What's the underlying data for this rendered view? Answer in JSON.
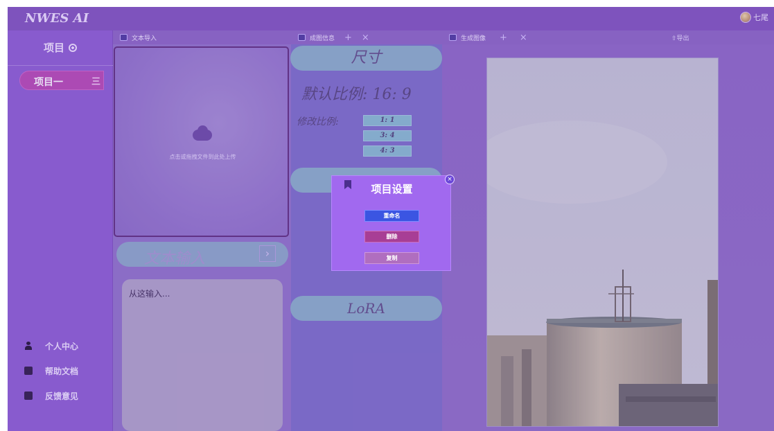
{
  "app": {
    "brand": "NWES AI",
    "user_name": "七尾"
  },
  "sidebar": {
    "header": "项目",
    "project_item": "项目一",
    "project_menu_icon": "三",
    "nav": [
      {
        "label": "个人中心",
        "icon": "person-icon"
      },
      {
        "label": "帮助文档",
        "icon": "help-doc-icon"
      },
      {
        "label": "反馈意见",
        "icon": "feedback-icon"
      }
    ]
  },
  "panels": {
    "text_import": {
      "tab": "文本导入",
      "upload_hint": "点击或拖拽文件到此处上传"
    },
    "text_input": {
      "title": "文本输入",
      "arrow": "›",
      "placeholder": "从这输入..."
    },
    "image_info": {
      "tab": "成图信息",
      "plus": "+",
      "close": "×",
      "dims_title": "尺寸",
      "default_ratio": "默认比例: 16: 9",
      "modify_label": "修改比例:",
      "ratios": [
        "1: 1",
        "3: 4",
        "4: 3"
      ],
      "lora": "LoRA"
    },
    "generated_image": {
      "tab": "生成图像",
      "plus": "+",
      "close": "×",
      "export": "导出"
    }
  },
  "modal": {
    "title": "项目设置",
    "close": "×",
    "buttons": {
      "rename": "重命名",
      "delete": "删除",
      "copy": "复制"
    }
  },
  "colors": {
    "accent": "#a169ef",
    "rename_button": "#3b55e2",
    "delete_button": "#a83e95",
    "project_pill": "#b84ab2"
  }
}
